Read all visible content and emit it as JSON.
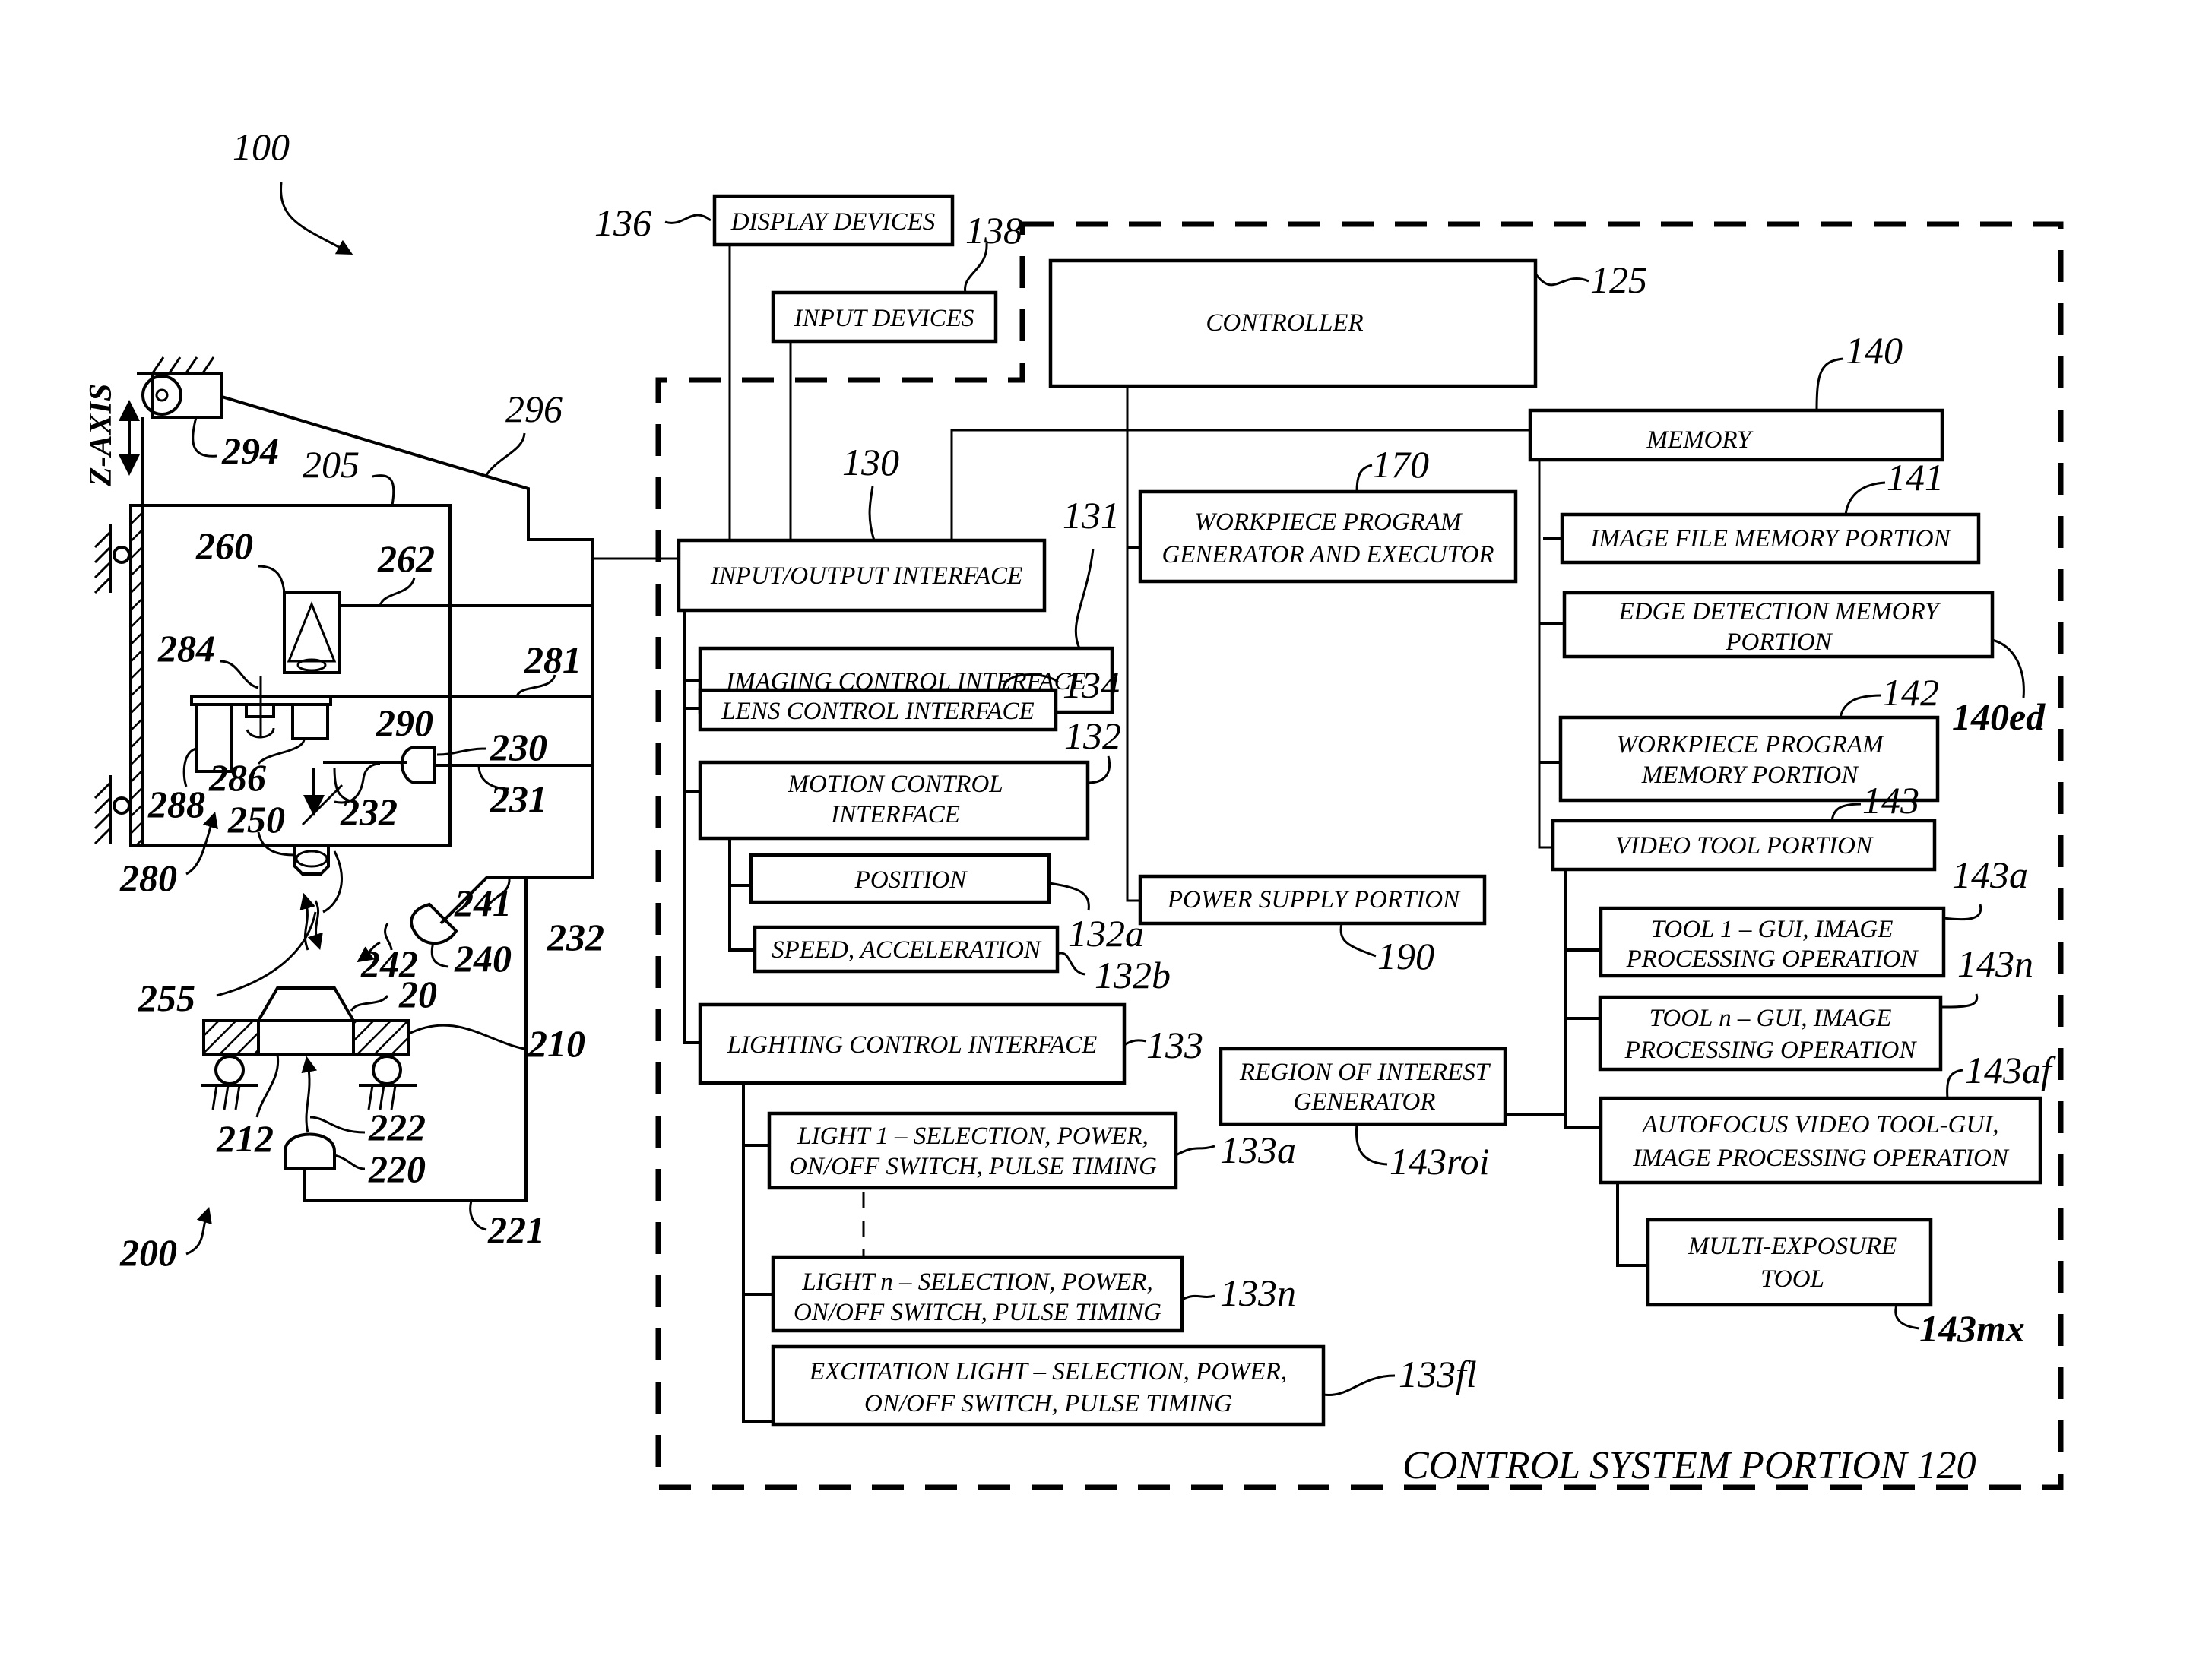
{
  "figure": {
    "system_ref": "100",
    "vision_machine_ref": "200",
    "z_axis_label": "Z-AXIS"
  },
  "control_system": {
    "label": "CONTROL SYSTEM PORTION 120"
  },
  "blocks": {
    "display_devices": {
      "label": "DISPLAY DEVICES",
      "ref": "136"
    },
    "input_devices": {
      "label": "INPUT DEVICES",
      "ref": "138"
    },
    "controller": {
      "label": "CONTROLLER",
      "ref": "125"
    },
    "io_interface": {
      "label": "INPUT/OUTPUT INTERFACE",
      "ref": "130"
    },
    "imaging_control": {
      "label": "IMAGING CONTROL INTERFACE",
      "ref": "131"
    },
    "lens_control": {
      "label": "LENS CONTROL INTERFACE",
      "ref": "134"
    },
    "motion_control": {
      "line1": "MOTION CONTROL",
      "line2": "INTERFACE",
      "ref": "132"
    },
    "position": {
      "label": "POSITION",
      "ref": "132a"
    },
    "speed_accel": {
      "label": "SPEED, ACCELERATION",
      "ref": "132b"
    },
    "lighting_control": {
      "label": "LIGHTING CONTROL INTERFACE",
      "ref": "133"
    },
    "light_1": {
      "line1": "LIGHT 1 – SELECTION, POWER,",
      "line2": "ON/OFF SWITCH, PULSE TIMING",
      "ref": "133a"
    },
    "light_n": {
      "line1": "LIGHT n – SELECTION, POWER,",
      "line2": "ON/OFF SWITCH, PULSE TIMING",
      "ref": "133n"
    },
    "excitation_light": {
      "line1": "EXCITATION LIGHT – SELECTION, POWER,",
      "line2": "ON/OFF SWITCH, PULSE TIMING",
      "ref": "133fl"
    },
    "workpiece_program_gen": {
      "line1": "WORKPIECE PROGRAM",
      "line2": "GENERATOR AND EXECUTOR",
      "ref": "170"
    },
    "power_supply": {
      "label": "POWER SUPPLY PORTION",
      "ref": "190"
    },
    "roi_generator": {
      "line1": "REGION OF INTEREST",
      "line2": "GENERATOR",
      "ref": "143roi"
    },
    "memory": {
      "label": "MEMORY",
      "ref": "140"
    },
    "image_file_memory": {
      "label": "IMAGE FILE MEMORY PORTION",
      "ref": "141"
    },
    "edge_detection_memory": {
      "line1": "EDGE DETECTION MEMORY",
      "line2": "PORTION",
      "ref": "140ed"
    },
    "workpiece_program_memory": {
      "line1": "WORKPIECE PROGRAM",
      "line2": "MEMORY PORTION",
      "ref": "142"
    },
    "video_tool": {
      "label": "VIDEO TOOL PORTION",
      "ref": "143"
    },
    "tool_1": {
      "line1": "TOOL 1 – GUI, IMAGE",
      "line2": "PROCESSING OPERATION",
      "ref": "143a"
    },
    "tool_n": {
      "line1": "TOOL n – GUI, IMAGE",
      "line2": "PROCESSING OPERATION",
      "ref": "143n"
    },
    "autofocus_tool": {
      "line1": "AUTOFOCUS VIDEO TOOL-GUI,",
      "line2": "IMAGE PROCESSING OPERATION",
      "ref": "143af"
    },
    "multi_exposure_tool": {
      "line1": "MULTI-EXPOSURE",
      "line2": "TOOL",
      "ref": "143mx"
    }
  },
  "machine_refs": {
    "workpiece": "20",
    "optical_assembly": "205",
    "stage": "210",
    "stage_window": "212",
    "stage_light": "220",
    "stage_light_cable": "221",
    "stage_light_rays": "222",
    "coaxial_light": "230",
    "coaxial_light_cable": "231",
    "signal_line": "232",
    "signal_line_2": "232",
    "signal_line_3": "232",
    "ring_light": "240",
    "ring_light_cable": "241",
    "ring_light_rays": "242",
    "objective_lens": "250",
    "workpiece_light": "255",
    "camera": "260",
    "camera_cable": "262",
    "turret": "280",
    "turret_cable": "281",
    "turret_axis": "284",
    "lens_a": "286",
    "lens_b": "288",
    "mirror": "290",
    "motor": "294",
    "motor_cable": "296"
  }
}
